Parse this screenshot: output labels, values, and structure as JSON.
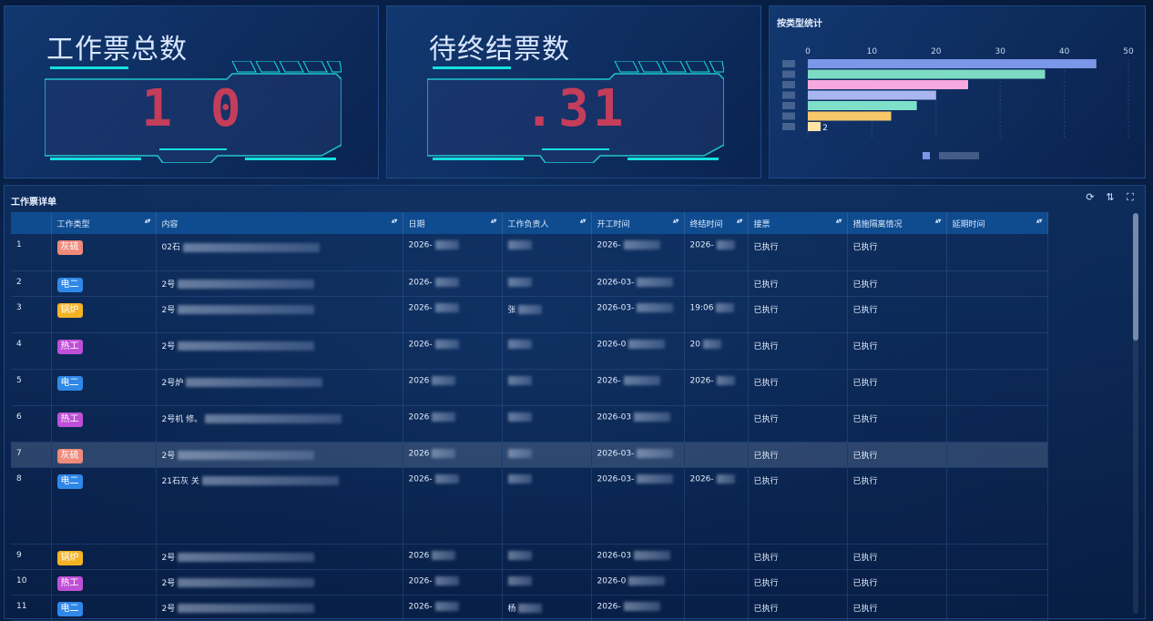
{
  "stats": {
    "total": {
      "title": "工作票总数",
      "value": "1 0"
    },
    "pending": {
      "title": "待终结票数",
      "value": ".31"
    }
  },
  "chart": {
    "title": "按类型统计",
    "colors": {
      "bar_a": "#7b97e8",
      "bar_b": "#7ddbc3",
      "bar_c": "#f5a9df",
      "bar_d": "#a9b6f0",
      "bar_e": "#7ee0c8",
      "bar_f": "#f7c86a"
    }
  },
  "chart_data": {
    "type": "bar",
    "orientation": "horizontal",
    "title": "按类型统计",
    "xlim": [
      0,
      50
    ],
    "xticks": [
      "0",
      "10",
      "20",
      "30",
      "40",
      "50"
    ],
    "values": [
      45,
      37,
      25,
      20,
      17,
      13,
      2
    ],
    "colors": [
      "#7b97e8",
      "#7ddbc3",
      "#f5a9df",
      "#a9b6f0",
      "#7ee0c8",
      "#f7c86a",
      "#fde3a6"
    ],
    "value_label": "2",
    "grid": true,
    "legend_position": "bottom"
  },
  "table": {
    "title": "工作票详单",
    "columns": [
      "",
      "工作类型",
      "内容",
      "日期",
      "工作负责人",
      "开工时间",
      "终结时间",
      "接票",
      "措施隔离情况",
      "延期时间"
    ],
    "tag_colors": {
      "灰硫": "#f08a7a",
      "电二": "#2f88e8",
      "锅炉": "#f5b324",
      "热工": "#c04fd8"
    },
    "rows": [
      {
        "no": "1",
        "type": "灰硫",
        "content": "02石",
        "date": "2026-",
        "owner": "",
        "start": "2026-",
        "end": "2026-",
        "accept": "已执行",
        "measure": "已执行",
        "delay": ""
      },
      {
        "no": "2",
        "type": "电二",
        "content": "2号",
        "date": "2026-",
        "owner": "",
        "start": "2026-03-",
        "end": "",
        "accept": "已执行",
        "measure": "已执行",
        "delay": ""
      },
      {
        "no": "3",
        "type": "锅炉",
        "content": "2号",
        "date": "2026-",
        "owner": "张",
        "start": "2026-03-",
        "end": "19:06",
        "accept": "已执行",
        "measure": "已执行",
        "delay": ""
      },
      {
        "no": "4",
        "type": "热工",
        "content": "2号",
        "date": "2026-",
        "owner": "",
        "start": "2026-0",
        "end": "20",
        "accept": "已执行",
        "measure": "已执行",
        "delay": ""
      },
      {
        "no": "5",
        "type": "电二",
        "content": "2号炉",
        "date": "2026",
        "owner": "",
        "start": "2026-",
        "end": "2026-",
        "accept": "已执行",
        "measure": "已执行",
        "delay": ""
      },
      {
        "no": "6",
        "type": "热工",
        "content": "2号机 修。",
        "date": "2026",
        "owner": "",
        "start": "2026-03",
        "end": "",
        "accept": "已执行",
        "measure": "已执行",
        "delay": ""
      },
      {
        "no": "7",
        "type": "灰硫",
        "content": "2号",
        "date": "2026",
        "owner": "",
        "start": "2026-03-",
        "end": "",
        "accept": "已执行",
        "measure": "已执行",
        "delay": ""
      },
      {
        "no": "8",
        "type": "电二",
        "content": "21石灰 关",
        "date": "2026-",
        "owner": "",
        "start": "2026-03-",
        "end": "2026-",
        "accept": "已执行",
        "measure": "已执行",
        "delay": ""
      },
      {
        "no": "9",
        "type": "锅炉",
        "content": "2号",
        "date": "2026",
        "owner": "",
        "start": "2026-03",
        "end": "",
        "accept": "已执行",
        "measure": "已执行",
        "delay": ""
      },
      {
        "no": "10",
        "type": "热工",
        "content": "2号",
        "date": "2026-",
        "owner": "",
        "start": "2026-0",
        "end": "",
        "accept": "已执行",
        "measure": "已执行",
        "delay": ""
      },
      {
        "no": "11",
        "type": "电二",
        "content": "2号",
        "date": "2026-",
        "owner": "杨",
        "start": "2026-",
        "end": "",
        "accept": "已执行",
        "measure": "已执行",
        "delay": ""
      }
    ]
  },
  "icons": {
    "refresh": "refresh-icon",
    "sort": "sort-icon",
    "fullscreen": "fullscreen-icon"
  }
}
